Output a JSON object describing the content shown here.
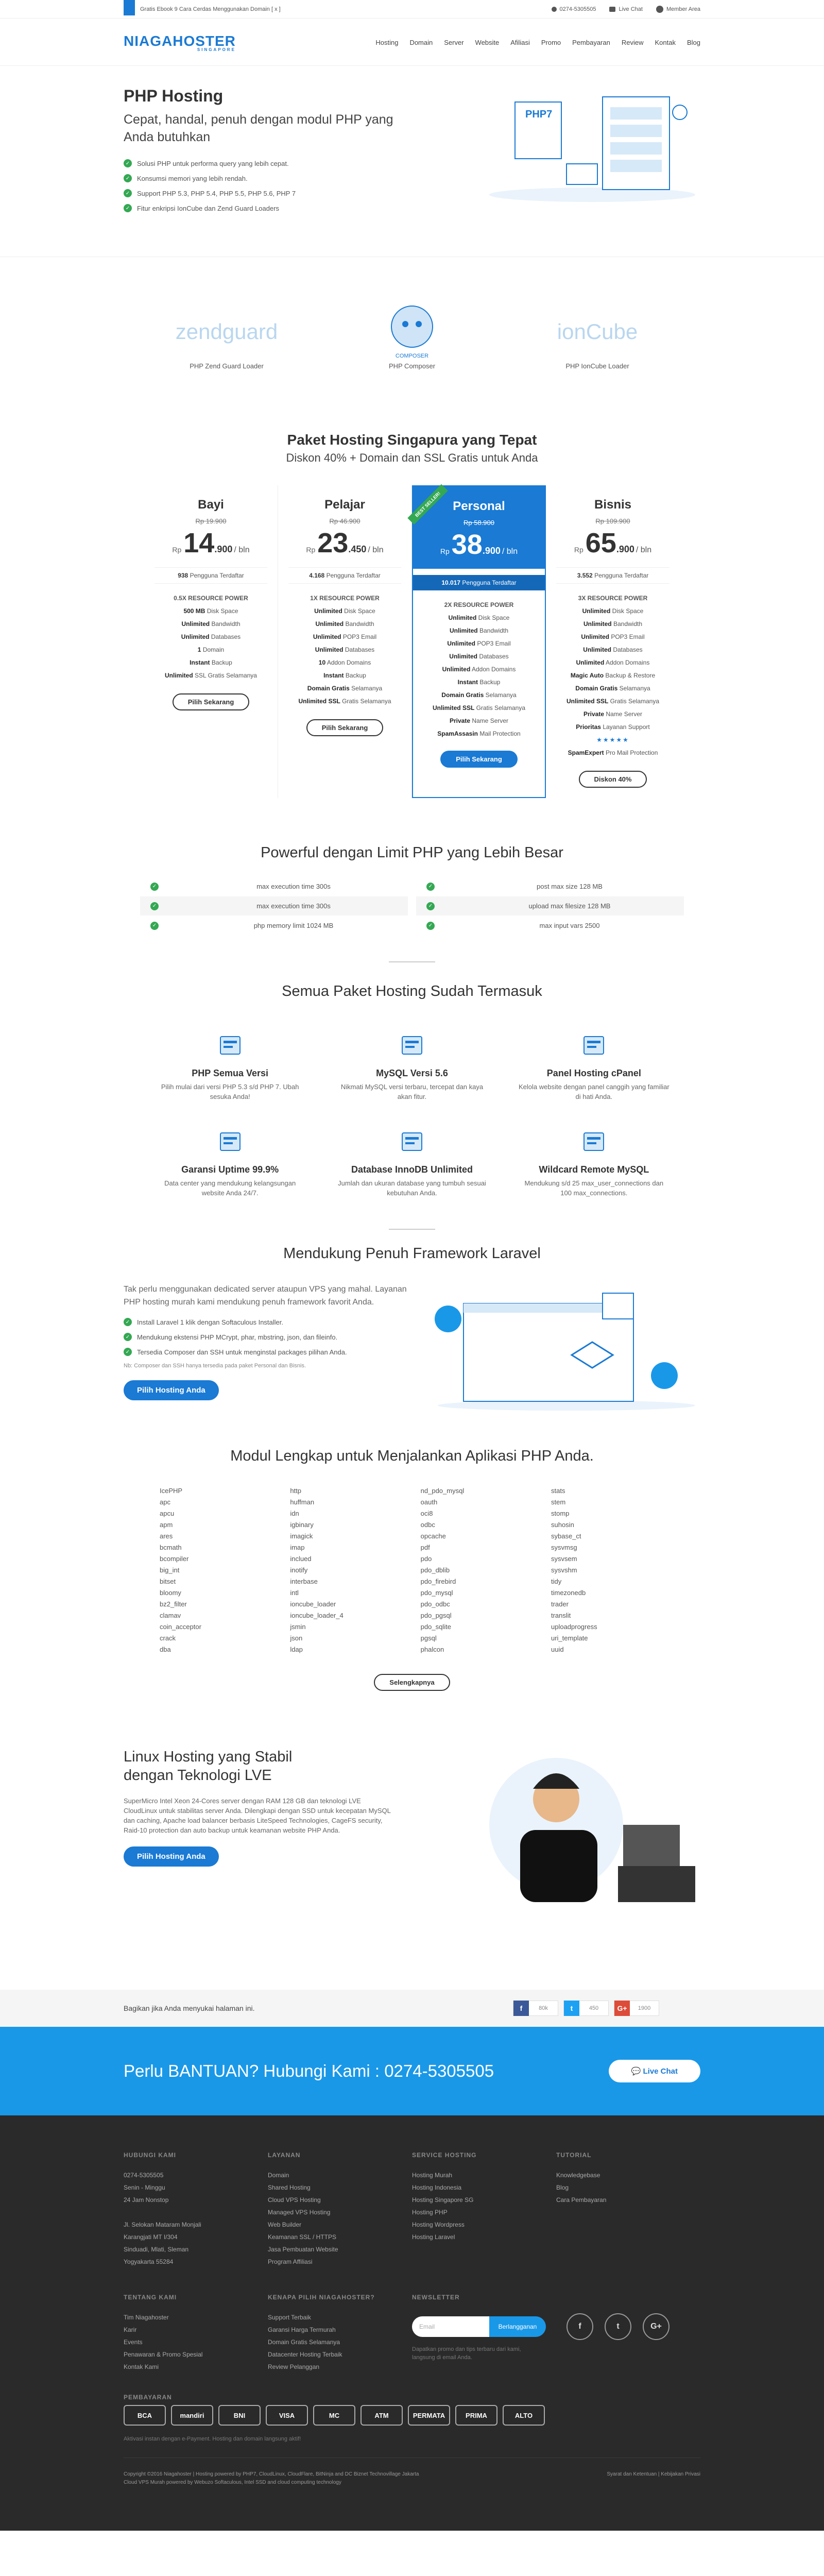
{
  "topbar": {
    "ebook": "Gratis Ebook 9 Cara Cerdas Menggunakan Domain [ x ]",
    "phone": "0274-5305505",
    "chat": "Live Chat",
    "member": "Member Area"
  },
  "logo": {
    "name": "NIAGAHOSTER",
    "tag": "SINGAPORE"
  },
  "nav": [
    "Hosting",
    "Domain",
    "Server",
    "Website",
    "Afiliasi",
    "Promo",
    "Pembayaran",
    "Review",
    "Kontak",
    "Blog"
  ],
  "hero": {
    "title": "PHP Hosting",
    "subtitle": "Cepat, handal, penuh dengan modul PHP yang Anda butuhkan",
    "points": [
      "Solusi PHP untuk performa query yang lebih cepat.",
      "Konsumsi memori yang lebih rendah.",
      "Support PHP 5.3, PHP 5.4, PHP 5.5, PHP 5.6, PHP 7",
      "Fitur enkripsi IonCube dan Zend Guard Loaders"
    ],
    "ill_label": "PHP7"
  },
  "loaders": [
    {
      "logo": "zendguard",
      "label": "PHP Zend Guard Loader"
    },
    {
      "logo": "COMPOSER",
      "label": "PHP Composer"
    },
    {
      "logo": "ionCube",
      "label": "PHP IonCube Loader"
    }
  ],
  "paket": {
    "title": "Paket Hosting Singapura yang Tepat",
    "subtitle": "Diskon 40% + Domain dan SSL Gratis untuk Anda",
    "ribbon": "BEST SELLER!",
    "plans": [
      {
        "name": "Bayi",
        "old": "Rp 19.900",
        "rp": "Rp",
        "big": "14",
        "cents": ".900",
        "per": "/ bln",
        "users": "938",
        "users_label": "Pengguna Terdaftar",
        "head": "0.5X RESOURCE POWER",
        "feats": [
          [
            "500 MB",
            "Disk Space"
          ],
          [
            "Unlimited",
            "Bandwidth"
          ],
          [
            "Unlimited",
            "Databases"
          ],
          [
            "1",
            "Domain"
          ],
          [
            "Instant",
            "Backup"
          ],
          [
            "Unlimited",
            "SSL Gratis Selamanya"
          ]
        ],
        "btn": "Pilih Sekarang"
      },
      {
        "name": "Pelajar",
        "old": "Rp 46.900",
        "rp": "Rp",
        "big": "23",
        "cents": ".450",
        "per": "/ bln",
        "users": "4.168",
        "users_label": "Pengguna Terdaftar",
        "head": "1X RESOURCE POWER",
        "feats": [
          [
            "Unlimited",
            "Disk Space"
          ],
          [
            "Unlimited",
            "Bandwidth"
          ],
          [
            "Unlimited",
            "POP3 Email"
          ],
          [
            "Unlimited",
            "Databases"
          ],
          [
            "10",
            "Addon Domains"
          ],
          [
            "Instant",
            "Backup"
          ],
          [
            "Domain Gratis",
            "Selamanya"
          ],
          [
            "Unlimited SSL",
            "Gratis Selamanya"
          ]
        ],
        "btn": "Pilih Sekarang"
      },
      {
        "name": "Personal",
        "old": "Rp 58.900",
        "rp": "Rp",
        "big": "38",
        "cents": ".900",
        "per": "/ bln",
        "users": "10.017",
        "users_label": "Pengguna Terdaftar",
        "head": "2X RESOURCE POWER",
        "feats": [
          [
            "Unlimited",
            "Disk Space"
          ],
          [
            "Unlimited",
            "Bandwidth"
          ],
          [
            "Unlimited",
            "POP3 Email"
          ],
          [
            "Unlimited",
            "Databases"
          ],
          [
            "Unlimited",
            "Addon Domains"
          ],
          [
            "Instant",
            "Backup"
          ],
          [
            "Domain Gratis",
            "Selamanya"
          ],
          [
            "Unlimited SSL",
            "Gratis Selamanya"
          ],
          [
            "Private",
            "Name Server"
          ],
          [
            "SpamAssasin",
            "Mail Protection"
          ]
        ],
        "btn": "Pilih Sekarang"
      },
      {
        "name": "Bisnis",
        "old": "Rp 109.900",
        "rp": "Rp",
        "big": "65",
        "cents": ".900",
        "per": "/ bln",
        "users": "3.552",
        "users_label": "Pengguna Terdaftar",
        "head": "3X RESOURCE POWER",
        "feats": [
          [
            "Unlimited",
            "Disk Space"
          ],
          [
            "Unlimited",
            "Bandwidth"
          ],
          [
            "Unlimited",
            "POP3 Email"
          ],
          [
            "Unlimited",
            "Databases"
          ],
          [
            "Unlimited",
            "Addon Domains"
          ],
          [
            "Magic Auto",
            "Backup & Restore"
          ],
          [
            "Domain Gratis",
            "Selamanya"
          ],
          [
            "Unlimited SSL",
            "Gratis Selamanya"
          ],
          [
            "Private",
            "Name Server"
          ],
          [
            "Prioritas",
            "Layanan Support"
          ],
          [
            "★★★★★",
            ""
          ],
          [
            "SpamExpert",
            "Pro Mail Protection"
          ]
        ],
        "btn": "Diskon 40%"
      }
    ]
  },
  "limits": {
    "title": "Powerful dengan Limit PHP yang Lebih Besar",
    "left": [
      "max execution time 300s",
      "max execution time 300s",
      "php memory limit 1024 MB"
    ],
    "right": [
      "post max size 128 MB",
      "upload max filesize 128 MB",
      "max input vars 2500"
    ]
  },
  "included": {
    "title": "Semua Paket Hosting Sudah Termasuk",
    "items": [
      {
        "icon": "php-icon",
        "title": "PHP Semua Versi",
        "desc": "Pilih mulai dari versi PHP 5.3 s/d PHP 7. Ubah sesuka Anda!"
      },
      {
        "icon": "mysql-icon",
        "title": "MySQL Versi 5.6",
        "desc": "Nikmati MySQL versi terbaru, tercepat dan kaya akan fitur."
      },
      {
        "icon": "cpanel-icon",
        "title": "Panel Hosting cPanel",
        "desc": "Kelola website dengan panel canggih yang familiar di hati Anda."
      },
      {
        "icon": "shield-icon",
        "title": "Garansi Uptime 99.9%",
        "desc": "Data center yang mendukung kelangsungan website Anda 24/7."
      },
      {
        "icon": "database-icon",
        "title": "Database InnoDB Unlimited",
        "desc": "Jumlah dan ukuran database yang tumbuh sesuai kebutuhan Anda."
      },
      {
        "icon": "remote-mysql-icon",
        "title": "Wildcard Remote MySQL",
        "desc": "Mendukung s/d 25 max_user_connections dan 100 max_connections."
      }
    ]
  },
  "laravel": {
    "title": "Mendukung Penuh Framework Laravel",
    "lead": "Tak perlu menggunakan dedicated server ataupun VPS yang mahal. Layanan PHP hosting murah kami mendukung penuh framework favorit Anda.",
    "points": [
      "Install Laravel 1 klik dengan Softaculous Installer.",
      "Mendukung ekstensi PHP MCrypt, phar, mbstring, json, dan fileinfo.",
      "Tersedia Composer dan SSH untuk menginstal packages pilihan Anda."
    ],
    "note": "Nb: Composer dan SSH hanya tersedia pada paket Personal dan Bisnis.",
    "btn": "Pilih Hosting Anda"
  },
  "modules": {
    "title": "Modul Lengkap untuk Menjalankan Aplikasi PHP Anda.",
    "cols": [
      [
        "IcePHP",
        "apc",
        "apcu",
        "apm",
        "ares",
        "bcmath",
        "bcompiler",
        "big_int",
        "bitset",
        "bloomy",
        "bz2_filter",
        "clamav",
        "coin_acceptor",
        "crack",
        "dba"
      ],
      [
        "http",
        "huffman",
        "idn",
        "igbinary",
        "imagick",
        "imap",
        "inclued",
        "inotify",
        "interbase",
        "intl",
        "ioncube_loader",
        "ioncube_loader_4",
        "jsmin",
        "json",
        "ldap"
      ],
      [
        "nd_pdo_mysql",
        "oauth",
        "oci8",
        "odbc",
        "opcache",
        "pdf",
        "pdo",
        "pdo_dblib",
        "pdo_firebird",
        "pdo_mysql",
        "pdo_odbc",
        "pdo_pgsql",
        "pdo_sqlite",
        "pgsql",
        "phalcon"
      ],
      [
        "stats",
        "stem",
        "stomp",
        "suhosin",
        "sybase_ct",
        "sysvmsg",
        "sysvsem",
        "sysvshm",
        "tidy",
        "timezonedb",
        "trader",
        "translit",
        "uploadprogress",
        "uri_template",
        "uuid"
      ]
    ],
    "btn": "Selengkapnya"
  },
  "lve": {
    "title": "Linux Hosting yang Stabil dengan Teknologi LVE",
    "text": "SuperMicro Intel Xeon 24-Cores server dengan RAM 128 GB dan teknologi LVE CloudLinux untuk stabilitas server Anda. Dilengkapi dengan SSD untuk kecepatan MySQL dan caching, Apache load balancer berbasis LiteSpeed Technologies, CageFS security, Raid-10 protection dan auto backup untuk keamanan website PHP Anda.",
    "btn": "Pilih Hosting Anda"
  },
  "share": {
    "text": "Bagikan jika Anda menyukai halaman ini.",
    "fb": "80k",
    "tw": "450",
    "gp": "1900"
  },
  "help": {
    "text": "Perlu BANTUAN? Hubungi Kami : 0274-5305505",
    "btn": "Live Chat"
  },
  "footer": {
    "c1": {
      "h": "HUBUNGI KAMI",
      "lines": [
        "0274-5305505",
        "Senin - Minggu",
        "24 Jam Nonstop",
        "",
        "Jl. Selokan Mataram Monjali",
        "Karangjati MT I/304",
        "Sinduadi, Mlati, Sleman",
        "Yogyakarta 55284"
      ]
    },
    "c2": {
      "h": "LAYANAN",
      "lines": [
        "Domain",
        "Shared Hosting",
        "Cloud VPS Hosting",
        "Managed VPS Hosting",
        "Web Builder",
        "Keamanan SSL / HTTPS",
        "Jasa Pembuatan Website",
        "Program Affiliasi"
      ]
    },
    "c3": {
      "h": "SERVICE HOSTING",
      "lines": [
        "Hosting Murah",
        "Hosting Indonesia",
        "Hosting Singapore SG",
        "Hosting PHP",
        "Hosting Wordpress",
        "Hosting Laravel"
      ]
    },
    "c4": {
      "h": "TUTORIAL",
      "lines": [
        "Knowledgebase",
        "Blog",
        "Cara Pembayaran"
      ]
    },
    "c5": {
      "h": "TENTANG KAMI",
      "lines": [
        "Tim Niagahoster",
        "Karir",
        "Events",
        "Penawaran & Promo Spesial",
        "Kontak Kami"
      ]
    },
    "c6": {
      "h": "KENAPA PILIH NIAGAHOSTER?",
      "lines": [
        "Support Terbaik",
        "Garansi Harga Termurah",
        "Domain Gratis Selamanya",
        "Datacenter Hosting Terbaik",
        "Review Pelanggan"
      ]
    },
    "c7": {
      "h": "NEWSLETTER",
      "placeholder": "Email",
      "btn": "Berlangganan",
      "note": "Dapatkan promo dan tips terbaru dari kami, langsung di email Anda."
    },
    "pay_h": "PEMBAYARAN",
    "pay": [
      "BCA",
      "mandiri",
      "BNI",
      "VISA",
      "MC",
      "ATM",
      "PERMATA",
      "PRIMA",
      "ALTO"
    ],
    "pay_note": "Aktivasi instan dengan e-Payment. Hosting dan domain langsung aktif!",
    "copy1": "Copyright ©2016 Niagahoster | Hosting powered by PHP7, CloudLinux, CloudFlare, BitNinja and DC Biznet Technovillage Jakarta",
    "copy2": "Cloud VPS Murah powered by Webuzo Softaculous, Intel SSD and cloud computing technology",
    "terms": "Syarat dan Ketentuan | Kebijakan Privasi"
  }
}
